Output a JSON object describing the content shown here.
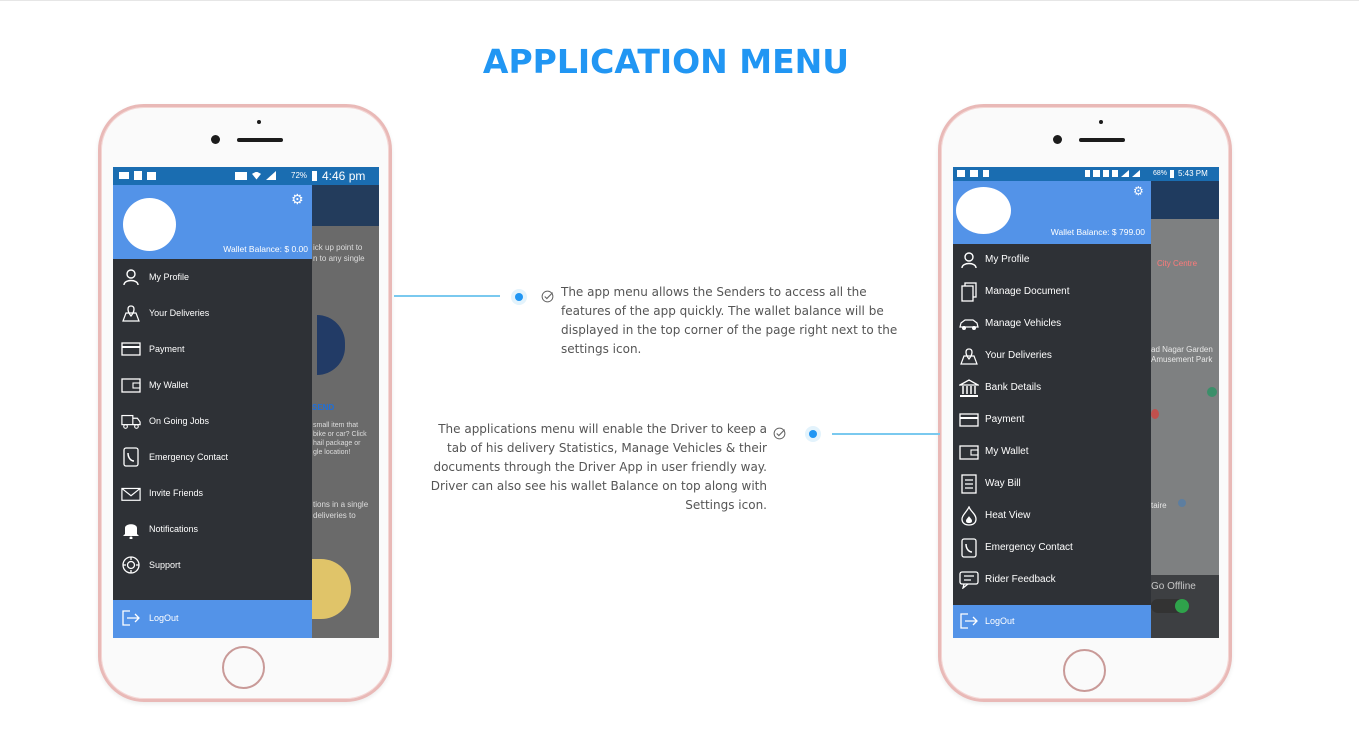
{
  "page_title": "APPLICATION MENU",
  "sender_phone": {
    "status_time": "4:46 pm",
    "battery": "72%",
    "wallet_balance": "Wallet Balance: $ 0.00",
    "menu": [
      {
        "icon": "user-icon",
        "label": "My Profile"
      },
      {
        "icon": "map-pin-icon",
        "label": "Your Deliveries"
      },
      {
        "icon": "credit-card-icon",
        "label": "Payment"
      },
      {
        "icon": "wallet-icon",
        "label": "My Wallet"
      },
      {
        "icon": "truck-icon",
        "label": "On Going Jobs"
      },
      {
        "icon": "phone-book-icon",
        "label": "Emergency Contact"
      },
      {
        "icon": "envelope-icon",
        "label": "Invite Friends"
      },
      {
        "icon": "bell-icon",
        "label": "Notifications"
      },
      {
        "icon": "support-icon",
        "label": "Support"
      }
    ],
    "logout": "LogOut",
    "background_texts": [
      "ick up point to",
      "n to any single",
      "SEND",
      "small item that",
      "bike or car? Click",
      "hail package or",
      "gle location!",
      "tions in a single",
      "deliveries to"
    ]
  },
  "driver_phone": {
    "status_time": "5:43 PM",
    "battery": "68%",
    "wallet_balance": "Wallet Balance: $ 799.00",
    "menu": [
      {
        "icon": "user-icon",
        "label": "My Profile"
      },
      {
        "icon": "document-icon",
        "label": "Manage Document"
      },
      {
        "icon": "car-icon",
        "label": "Manage Vehicles"
      },
      {
        "icon": "map-pin-icon",
        "label": "Your Deliveries"
      },
      {
        "icon": "bank-icon",
        "label": "Bank Details"
      },
      {
        "icon": "credit-card-icon",
        "label": "Payment"
      },
      {
        "icon": "wallet-icon",
        "label": "My Wallet"
      },
      {
        "icon": "way-bill-icon",
        "label": "Way Bill"
      },
      {
        "icon": "flame-icon",
        "label": "Heat View"
      },
      {
        "icon": "phone-book-icon",
        "label": "Emergency Contact"
      },
      {
        "icon": "feedback-icon",
        "label": "Rider Feedback"
      }
    ],
    "logout": "LogOut",
    "map_texts": [
      "City Centre",
      "ad Nagar Garden",
      "Amusement Park",
      "taire",
      "Go Offline"
    ]
  },
  "sender_description": "The app menu allows the Senders to access all the features of the app quickly. The wallet balance will be displayed in the top corner of the page right next to the settings icon.",
  "driver_description": "The applications menu will enable the Driver to keep a tab of his delivery Statistics, Manage Vehicles & their documents through the Driver App in user friendly way. Driver can also see his wallet Balance on top along with Settings icon."
}
